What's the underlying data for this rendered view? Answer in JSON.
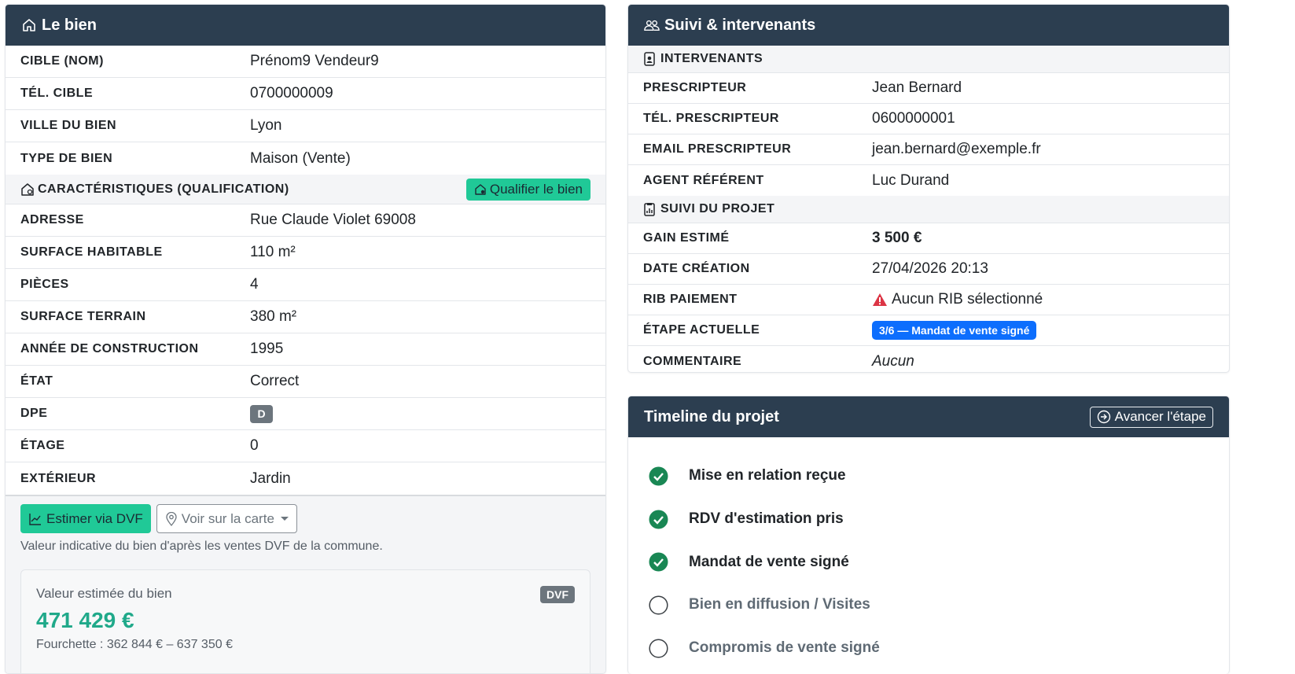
{
  "bien": {
    "title": "Le bien",
    "rows": [
      {
        "label": "Cible (nom)",
        "value": "Prénom9 Vendeur9"
      },
      {
        "label": "Tél. cible",
        "value": "0700000009"
      },
      {
        "label": "Ville du bien",
        "value": "Lyon"
      },
      {
        "label": "Type de bien",
        "value": "Maison (Vente)"
      }
    ],
    "qualif": {
      "title": "Caractéristiques (qualification)",
      "button": "Qualifier le bien",
      "rows": [
        {
          "label": "Adresse",
          "value": "Rue Claude Violet 69008"
        },
        {
          "label": "Surface habitable",
          "value": "110 m²"
        },
        {
          "label": "Pièces",
          "value": "4"
        },
        {
          "label": "Surface terrain",
          "value": "380 m²"
        },
        {
          "label": "Année de construction",
          "value": "1995"
        },
        {
          "label": "État",
          "value": "Correct"
        },
        {
          "label": "DPE",
          "value": "D"
        },
        {
          "label": "Étage",
          "value": "0"
        },
        {
          "label": "Extérieur",
          "value": "Jardin"
        }
      ]
    },
    "tools": {
      "estimate_button": "Estimer via DVF",
      "map_button": "Voir sur la carte",
      "hint": "Valeur indicative du bien d'après les ventes DVF de la commune.",
      "estimate_label": "Valeur estimée du bien",
      "estimate_value": "471 429 €",
      "estimate_range": "Fourchette : 362 844 € – 637 350 €",
      "badge": "DVF"
    }
  },
  "suivi": {
    "title": "Suivi & intervenants",
    "intervenants_title": "Intervenants",
    "intervenants": [
      {
        "label": "Prescripteur",
        "value": "Jean Bernard"
      },
      {
        "label": "Tél. prescripteur",
        "value": "0600000001"
      },
      {
        "label": "Email prescripteur",
        "value": "jean.bernard@exemple.fr"
      },
      {
        "label": "Agent référent",
        "value": "Luc Durand"
      }
    ],
    "projet_title": "Suivi du projet",
    "projet": {
      "gain_label": "Gain estimé",
      "gain_value": "3 500 €",
      "date_label": "Date création",
      "date_value": "27/04/2026 20:13",
      "rib_label": "RIB paiement",
      "rib_value": "Aucun RIB sélectionné",
      "step_label": "Étape actuelle",
      "step_value": "3/6 — Mandat de vente signé",
      "comment_label": "Commentaire",
      "comment_value": "Aucun"
    }
  },
  "timeline": {
    "title": "Timeline du projet",
    "advance_button": "Avancer l'étape",
    "steps": [
      {
        "label": "Mise en relation reçue",
        "done": true
      },
      {
        "label": "RDV d'estimation pris",
        "done": true
      },
      {
        "label": "Mandat de vente signé",
        "done": true
      },
      {
        "label": "Bien en diffusion / Visites",
        "done": false
      },
      {
        "label": "Compromis de vente signé",
        "done": false
      }
    ]
  },
  "colors": {
    "header": "#2c3e50",
    "accent_teal": "#20c997",
    "success": "#198754",
    "danger": "#dc3545",
    "primary": "#0d6efd"
  }
}
